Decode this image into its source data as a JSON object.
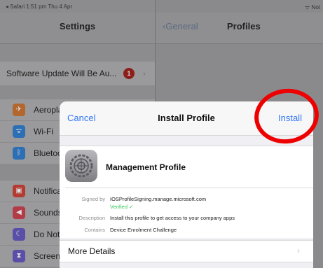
{
  "status_bar": {
    "left": "◂ Safari  1:51 pm  Thu 4 Apr",
    "right": "ᯤ Not"
  },
  "left_pane": {
    "title": "Settings",
    "update": {
      "label": "Software Update Will Be Au...",
      "badge": "1"
    },
    "group1": [
      {
        "label": "Aeroplane",
        "icon": "airplane-icon",
        "color": "#b3662e",
        "glyph": "✈"
      },
      {
        "label": "Wi-Fi",
        "icon": "wifi-icon",
        "color": "#2d6fb5",
        "glyph": "ᯤ"
      },
      {
        "label": "Bluetooth",
        "icon": "bluetooth-icon",
        "color": "#2d6fb5",
        "glyph": "ᛒ"
      }
    ],
    "group2": [
      {
        "label": "Notifications",
        "icon": "notifications-icon",
        "color": "#b33b32",
        "glyph": "▣"
      },
      {
        "label": "Sounds",
        "icon": "sounds-icon",
        "color": "#b33b48",
        "glyph": "◀"
      },
      {
        "label": "Do Not",
        "icon": "moon-icon",
        "color": "#5a4fa8",
        "glyph": "☾"
      },
      {
        "label": "Screen",
        "icon": "hourglass-icon",
        "color": "#5a4fa8",
        "glyph": "⧗"
      }
    ]
  },
  "right_pane": {
    "back": "General",
    "title": "Profiles"
  },
  "modal": {
    "cancel": "Cancel",
    "title": "Install Profile",
    "install": "Install",
    "profile_name": "Management Profile",
    "signed_by_key": "Signed by",
    "signed_by_value": "IOSProfileSigning.manage.microsoft.com",
    "verified": "Verified ✓",
    "description_key": "Description",
    "description_value": "Install this profile to get access to your company apps",
    "contains_key": "Contains",
    "contains_value": "Device Enrolment Challenge",
    "more_details": "More Details"
  },
  "colors": {
    "accent": "#3478f6",
    "verified": "#34c759",
    "annotation": "#ee0000"
  }
}
